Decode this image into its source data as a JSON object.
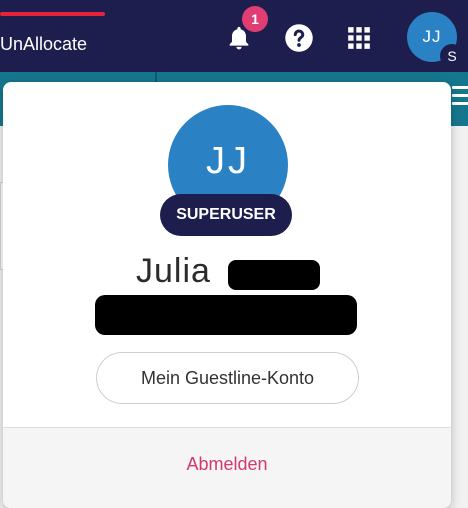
{
  "header": {
    "app_title": "UnAllocate",
    "notification_count": "1",
    "user_initials": "JJ",
    "user_badge_letter": "S",
    "colors": {
      "bar": "#1d1e4d",
      "accent_line": "#e5243b",
      "badge": "#e03e73",
      "avatar": "#2a82c4"
    }
  },
  "icons": [
    "bell-icon",
    "help-icon",
    "apps-grid-icon",
    "menu-icon"
  ],
  "profile_popup": {
    "initials": "JJ",
    "role": "SUPERUSER",
    "first_name": "Julia",
    "account_button": "Mein Guestline-Konto",
    "logout_button": "Abmelden",
    "logout_color": "#d33a6a"
  }
}
